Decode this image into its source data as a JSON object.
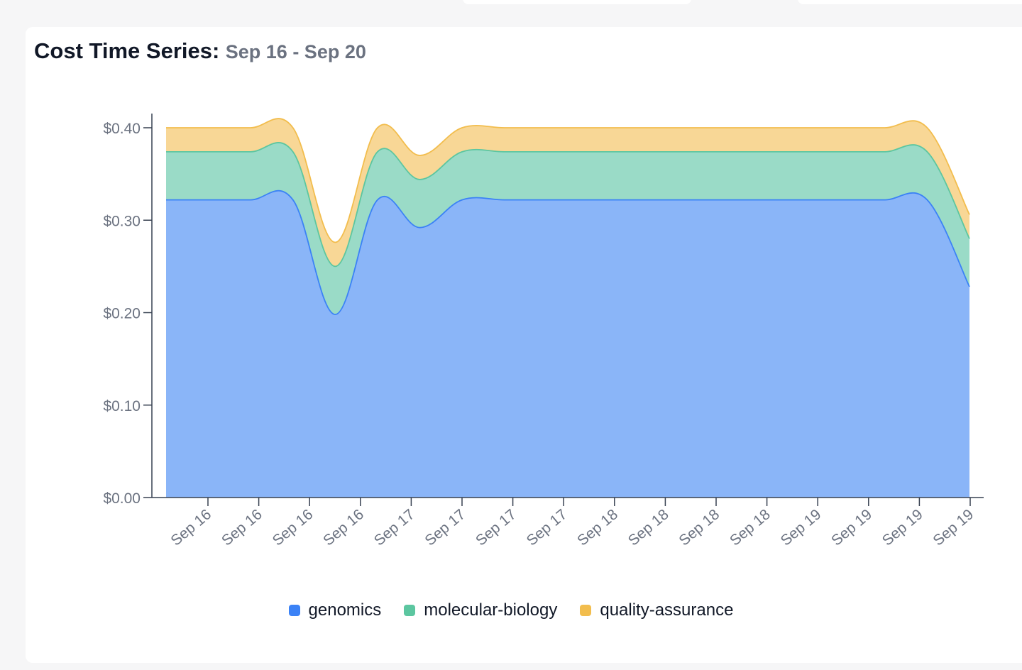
{
  "header": {
    "title": "Cost Time Series:",
    "date_range": "Sep 16 - Sep 20"
  },
  "colors": {
    "genomics": "#3b82f6",
    "molecular-biology": "#5cc6a0",
    "quality-assurance": "#f2bd4d"
  },
  "chart_data": {
    "type": "area",
    "stacked": true,
    "title": "Cost Time Series:",
    "subtitle": "Sep 16 - Sep 20",
    "xlabel": "",
    "ylabel": "",
    "ylim": [
      0,
      0.4
    ],
    "y_ticks": [
      "$0.00",
      "$0.10",
      "$0.20",
      "$0.30",
      "$0.40"
    ],
    "y_tick_values": [
      0,
      0.1,
      0.2,
      0.3,
      0.4
    ],
    "x_tick_labels": [
      "Sep 16",
      "Sep 16",
      "Sep 16",
      "Sep 16",
      "Sep 17",
      "Sep 17",
      "Sep 17",
      "Sep 17",
      "Sep 18",
      "Sep 18",
      "Sep 18",
      "Sep 18",
      "Sep 19",
      "Sep 19",
      "Sep 19",
      "Sep 19"
    ],
    "x": [
      "Sep 16 00:00",
      "Sep 16 06:00",
      "Sep 16 12:00",
      "Sep 16 18:00",
      "Sep 16 21:00",
      "Sep 17 00:00",
      "Sep 17 03:00",
      "Sep 17 06:00",
      "Sep 17 12:00",
      "Sep 17 18:00",
      "Sep 18 00:00",
      "Sep 18 06:00",
      "Sep 18 12:00",
      "Sep 18 18:00",
      "Sep 19 00:00",
      "Sep 19 06:00",
      "Sep 19 12:00",
      "Sep 19 18:00",
      "Sep 19 21:00",
      "Sep 20 00:00"
    ],
    "series": [
      {
        "name": "genomics",
        "values": [
          0.322,
          0.322,
          0.322,
          0.322,
          0.198,
          0.322,
          0.292,
          0.322,
          0.322,
          0.322,
          0.322,
          0.322,
          0.322,
          0.322,
          0.322,
          0.322,
          0.322,
          0.322,
          0.322,
          0.228
        ]
      },
      {
        "name": "molecular-biology",
        "values": [
          0.052,
          0.052,
          0.052,
          0.052,
          0.052,
          0.052,
          0.052,
          0.052,
          0.052,
          0.052,
          0.052,
          0.052,
          0.052,
          0.052,
          0.052,
          0.052,
          0.052,
          0.052,
          0.052,
          0.052
        ]
      },
      {
        "name": "quality-assurance",
        "values": [
          0.026,
          0.026,
          0.026,
          0.026,
          0.026,
          0.026,
          0.026,
          0.026,
          0.026,
          0.026,
          0.026,
          0.026,
          0.026,
          0.026,
          0.026,
          0.026,
          0.026,
          0.026,
          0.026,
          0.026
        ]
      }
    ],
    "grid": false,
    "legend_position": "bottom-center"
  }
}
